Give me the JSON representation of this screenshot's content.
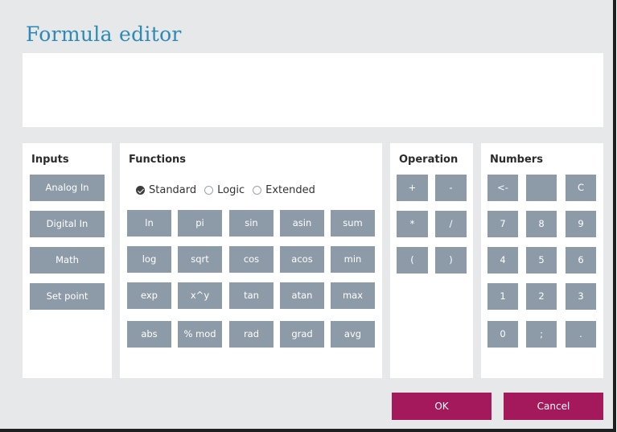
{
  "dialog": {
    "title": "Formula editor",
    "formula_value": ""
  },
  "inputs": {
    "title": "Inputs",
    "buttons": [
      "Analog In",
      "Digital In",
      "Math",
      "Set point"
    ]
  },
  "functions": {
    "title": "Functions",
    "modes": [
      {
        "label": "Standard",
        "checked": true
      },
      {
        "label": "Logic",
        "checked": false
      },
      {
        "label": "Extended",
        "checked": false
      }
    ],
    "rows": [
      [
        "ln",
        "pi",
        "sin",
        "asin",
        "sum"
      ],
      [
        "log",
        "sqrt",
        "cos",
        "acos",
        "min"
      ],
      [
        "exp",
        "x^y",
        "tan",
        "atan",
        "max"
      ],
      [
        "abs",
        "% mod",
        "rad",
        "grad",
        "avg"
      ]
    ]
  },
  "operation": {
    "title": "Operation",
    "rows": [
      [
        "+",
        "-"
      ],
      [
        "*",
        "/"
      ],
      [
        "(",
        ")"
      ]
    ]
  },
  "numbers": {
    "title": "Numbers",
    "rows": [
      [
        "<-",
        "",
        "C"
      ],
      [
        "7",
        "8",
        "9"
      ],
      [
        "4",
        "5",
        "6"
      ],
      [
        "1",
        "2",
        "3"
      ],
      [
        "0",
        ";",
        "."
      ]
    ]
  },
  "actions": {
    "ok_label": "OK",
    "cancel_label": "Cancel"
  },
  "colors": {
    "key_button": "#8d9aa8",
    "action_button": "#a3195b",
    "title": "#2e8ab4",
    "background": "#e6e8ea"
  }
}
